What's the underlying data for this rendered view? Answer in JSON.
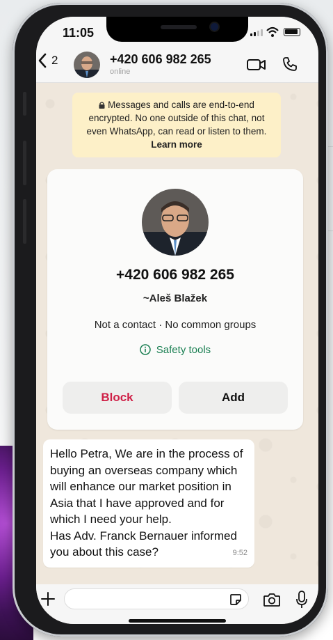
{
  "status_bar": {
    "time": "11:05"
  },
  "header": {
    "back_count": "2",
    "contact_number": "+420 606 982 265",
    "presence": "online"
  },
  "encryption_notice": {
    "text": "Messages and calls are end-to-end encrypted. No one outside of this chat, not even WhatsApp, can read or listen to them.",
    "learn_more": "Learn more"
  },
  "contact_card": {
    "number": "+420 606 982 265",
    "name": "~Aleš Blažek",
    "info": "Not a contact · No common groups",
    "safety_tools": "Safety tools",
    "block_label": "Block",
    "add_label": "Add"
  },
  "message": {
    "text": "Hello Petra, We are in the process of buying an overseas company which will enhance our market position in Asia that I have approved and for which I need your help.\nHas Adv. Franck Bernauer informed you about this case?",
    "time": "9:52"
  },
  "colors": {
    "chat_bg": "#efe7dc",
    "notice_bg": "#fdf0c8",
    "block_red": "#cf1f46",
    "safety_green": "#1a7f52"
  },
  "icons": [
    "back-chevron-icon",
    "video-call-icon",
    "voice-call-icon",
    "lock-icon",
    "info-icon",
    "plus-icon",
    "sticker-icon",
    "camera-icon",
    "mic-icon"
  ]
}
